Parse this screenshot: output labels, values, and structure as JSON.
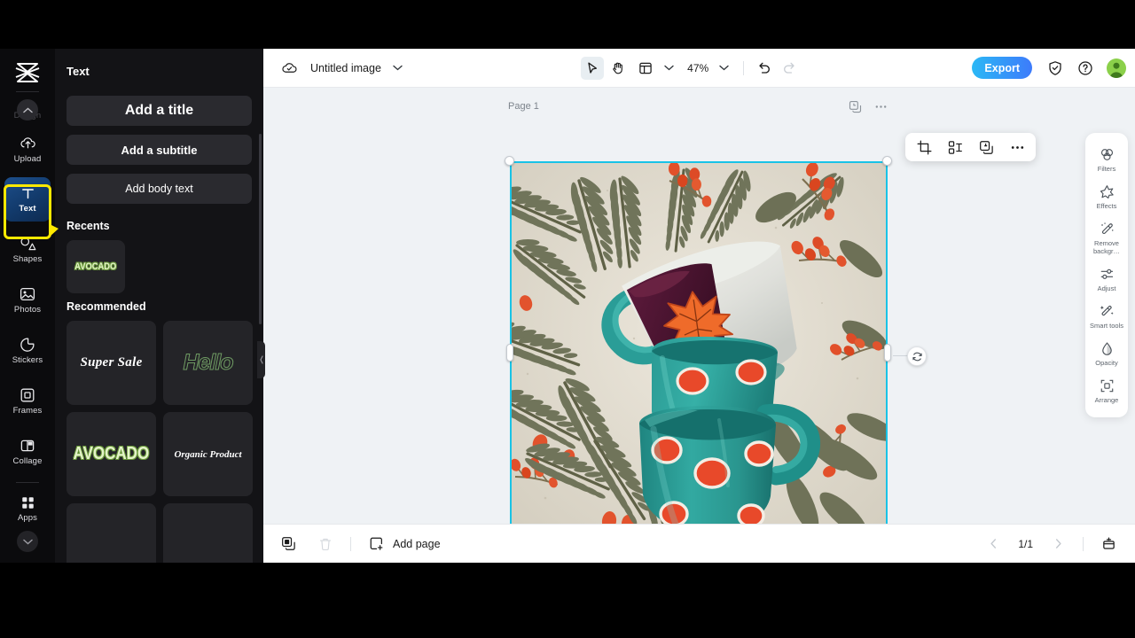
{
  "rail": {
    "logo_icon": "capcut-logo-icon",
    "design_label": "Design",
    "collapse_icon": "chevron-up-icon",
    "expand_icon": "chevron-down-icon",
    "items": [
      {
        "label": "Upload",
        "icon": "upload-cloud-icon",
        "active": false
      },
      {
        "label": "Text",
        "icon": "text-t-icon",
        "active": true
      },
      {
        "label": "Shapes",
        "icon": "shapes-icon",
        "active": false
      },
      {
        "label": "Photos",
        "icon": "photo-icon",
        "active": false
      },
      {
        "label": "Stickers",
        "icon": "sticker-icon",
        "active": false
      },
      {
        "label": "Frames",
        "icon": "frames-icon",
        "active": false
      },
      {
        "label": "Collage",
        "icon": "collage-icon",
        "active": false
      },
      {
        "label": "Apps",
        "icon": "apps-grid-icon",
        "active": false
      }
    ]
  },
  "panel": {
    "title": "Text",
    "add_title": "Add a title",
    "add_subtitle": "Add a subtitle",
    "add_body": "Add body text",
    "recents_heading": "Recents",
    "recommended_heading": "Recommended",
    "recents": [
      {
        "label": "AVOCADO",
        "style": "avocado"
      }
    ],
    "recommended": [
      {
        "label": "Super Sale",
        "style": "supersale"
      },
      {
        "label": "Hello",
        "style": "hello"
      },
      {
        "label": "AVOCADO",
        "style": "avocado"
      },
      {
        "label": "Organic Product",
        "style": "organic"
      },
      {
        "label": "",
        "style": "teal"
      },
      {
        "label": "",
        "style": "plain"
      }
    ]
  },
  "topbar": {
    "cloud_icon": "cloud-saved-icon",
    "doc_name": "Untitled image",
    "doc_dropdown_icon": "chevron-down-icon",
    "select_icon": "cursor-arrow-icon",
    "hand_icon": "hand-pan-icon",
    "layout_icon": "layout-panel-icon",
    "layout_dropdown_icon": "chevron-down-icon",
    "zoom_value": "47%",
    "zoom_dropdown_icon": "chevron-down-icon",
    "undo_icon": "undo-arrow-icon",
    "redo_icon": "redo-arrow-icon",
    "export_label": "Export",
    "shield_icon": "shield-check-icon",
    "help_icon": "question-circle-icon",
    "avatar_icon": "user-avatar-icon"
  },
  "canvas": {
    "page_label": "Page 1",
    "page_duplicate_icon": "duplicate-page-icon",
    "page_more_icon": "more-horizontal-icon",
    "rotate_icon": "rotate-handle-icon",
    "accent_color": "#19c3e6",
    "background_color": "#eff2f5",
    "floating_toolbar": [
      {
        "icon": "crop-icon"
      },
      {
        "icon": "cutout-icon"
      },
      {
        "icon": "duplicate-icon"
      },
      {
        "icon": "more-horizontal-icon"
      }
    ]
  },
  "right_panel": {
    "items": [
      {
        "label": "Filters",
        "icon": "filters-circles-icon"
      },
      {
        "label": "Effects",
        "icon": "effects-sparkle-icon"
      },
      {
        "label": "Remove backgr…",
        "icon": "remove-background-wand-icon"
      },
      {
        "label": "Adjust",
        "icon": "adjust-sliders-icon"
      },
      {
        "label": "Smart tools",
        "icon": "smart-tools-wand-icon"
      },
      {
        "label": "Opacity",
        "icon": "opacity-drop-icon"
      },
      {
        "label": "Arrange",
        "icon": "arrange-frame-icon"
      }
    ]
  },
  "bottombar": {
    "duplicate_icon": "duplicate-page-icon",
    "delete_icon": "trash-icon",
    "add_page_label": "Add page",
    "add_page_icon": "add-page-icon",
    "prev_icon": "chevron-left-icon",
    "page_indicator": "1/1",
    "next_icon": "chevron-right-icon",
    "present_icon": "present-icon"
  },
  "artwork": {
    "description": "Flat-lay photo of two teal polka-dot mugs stacked on a cream speckled surface with fern fronds, olive leaves and orange berries; the top mug is tilted showing dark wine-red liquid and an orange maple leaf.",
    "colors": {
      "background": "#ddd8cc",
      "mug": "#2d9a95",
      "dot": "#e8492a",
      "fern": "#6f7055",
      "berry": "#e2532d",
      "liquid": "#4a1430"
    }
  }
}
